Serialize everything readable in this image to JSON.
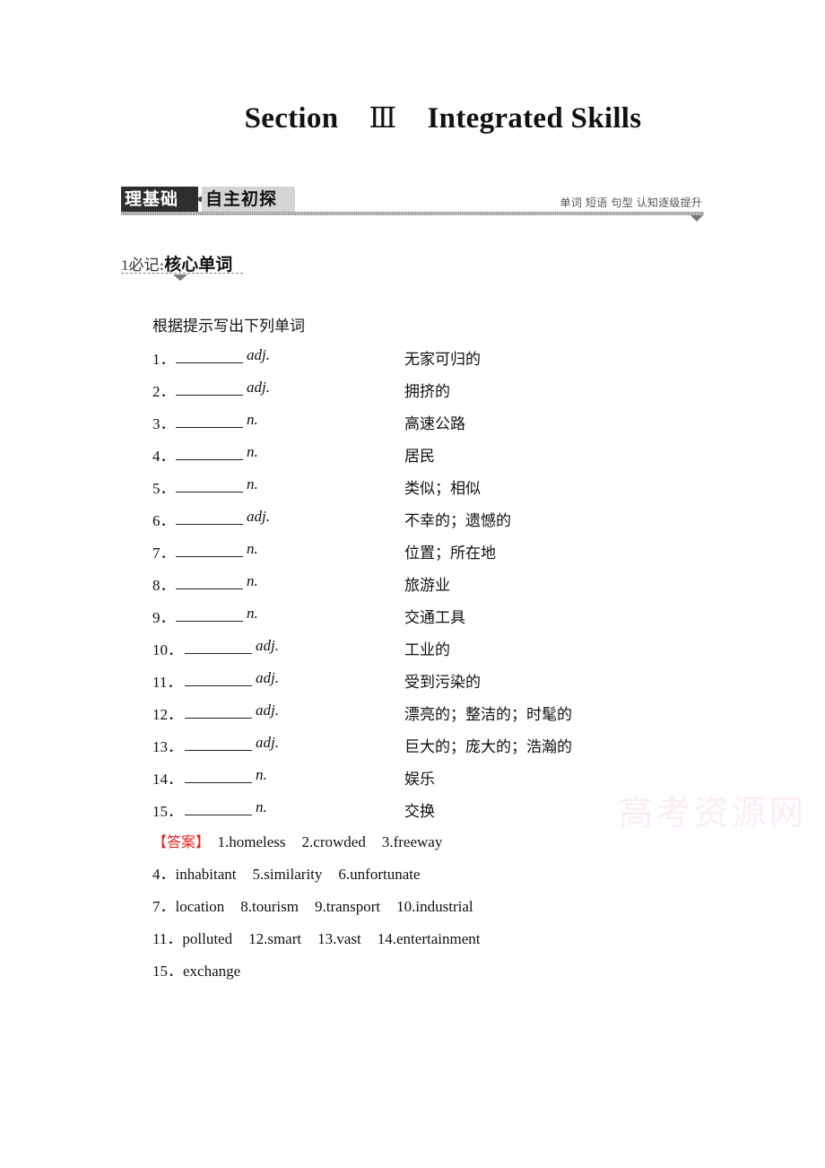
{
  "title": {
    "section": "Section",
    "roman": "Ⅲ",
    "name": "Integrated Skills"
  },
  "banner": {
    "dark_label": "理基础",
    "light_label": "自主初探",
    "tagline": "单词 短语 句型  认知逐级提升",
    "arrow_icon": "triangle-down"
  },
  "subhead": {
    "number": "1",
    "prefix": "必记:",
    "title": "核心单词"
  },
  "instruction": "根据提示写出下列单词",
  "items": [
    {
      "num": "1．",
      "pos": "adj.",
      "meaning": "无家可归的"
    },
    {
      "num": "2．",
      "pos": "adj.",
      "meaning": "拥挤的"
    },
    {
      "num": "3．",
      "pos": "n.",
      "meaning": "高速公路"
    },
    {
      "num": "4．",
      "pos": "n.",
      "meaning": "居民"
    },
    {
      "num": "5．",
      "pos": "n.",
      "meaning": "类似；相似"
    },
    {
      "num": "6．",
      "pos": "adj.",
      "meaning": "不幸的；遗憾的"
    },
    {
      "num": "7．",
      "pos": "n.",
      "meaning": "位置；所在地"
    },
    {
      "num": "8．",
      "pos": "n.",
      "meaning": "旅游业"
    },
    {
      "num": "9．",
      "pos": "n.",
      "meaning": "交通工具"
    },
    {
      "num": "10．",
      "pos": "adj.",
      "meaning": "工业的"
    },
    {
      "num": "11．",
      "pos": "adj.",
      "meaning": "受到污染的"
    },
    {
      "num": "12．",
      "pos": "adj.",
      "meaning": "漂亮的；整洁的；时髦的"
    },
    {
      "num": "13．",
      "pos": "adj.",
      "meaning": "巨大的；庞大的；浩瀚的"
    },
    {
      "num": "14．",
      "pos": "n.",
      "meaning": "娱乐"
    },
    {
      "num": "15．",
      "pos": "n.",
      "meaning": "交换"
    }
  ],
  "answers": {
    "label": "【答案】",
    "lines": [
      [
        "1.homeless",
        "2.crowded",
        "3.freeway"
      ],
      [
        "4．inhabitant",
        "5.similarity",
        "6.unfortunate"
      ],
      [
        "7．location",
        "8.tourism",
        "9.transport",
        "10.industrial"
      ],
      [
        "11．polluted",
        "12.smart",
        "13.vast",
        "14.entertainment"
      ],
      [
        "15．exchange"
      ]
    ]
  },
  "watermark": "高考资源网",
  "colors": {
    "answer_label": "#e8201b",
    "banner_dark": "#2d2d2d",
    "banner_light": "#d4d4d4"
  }
}
